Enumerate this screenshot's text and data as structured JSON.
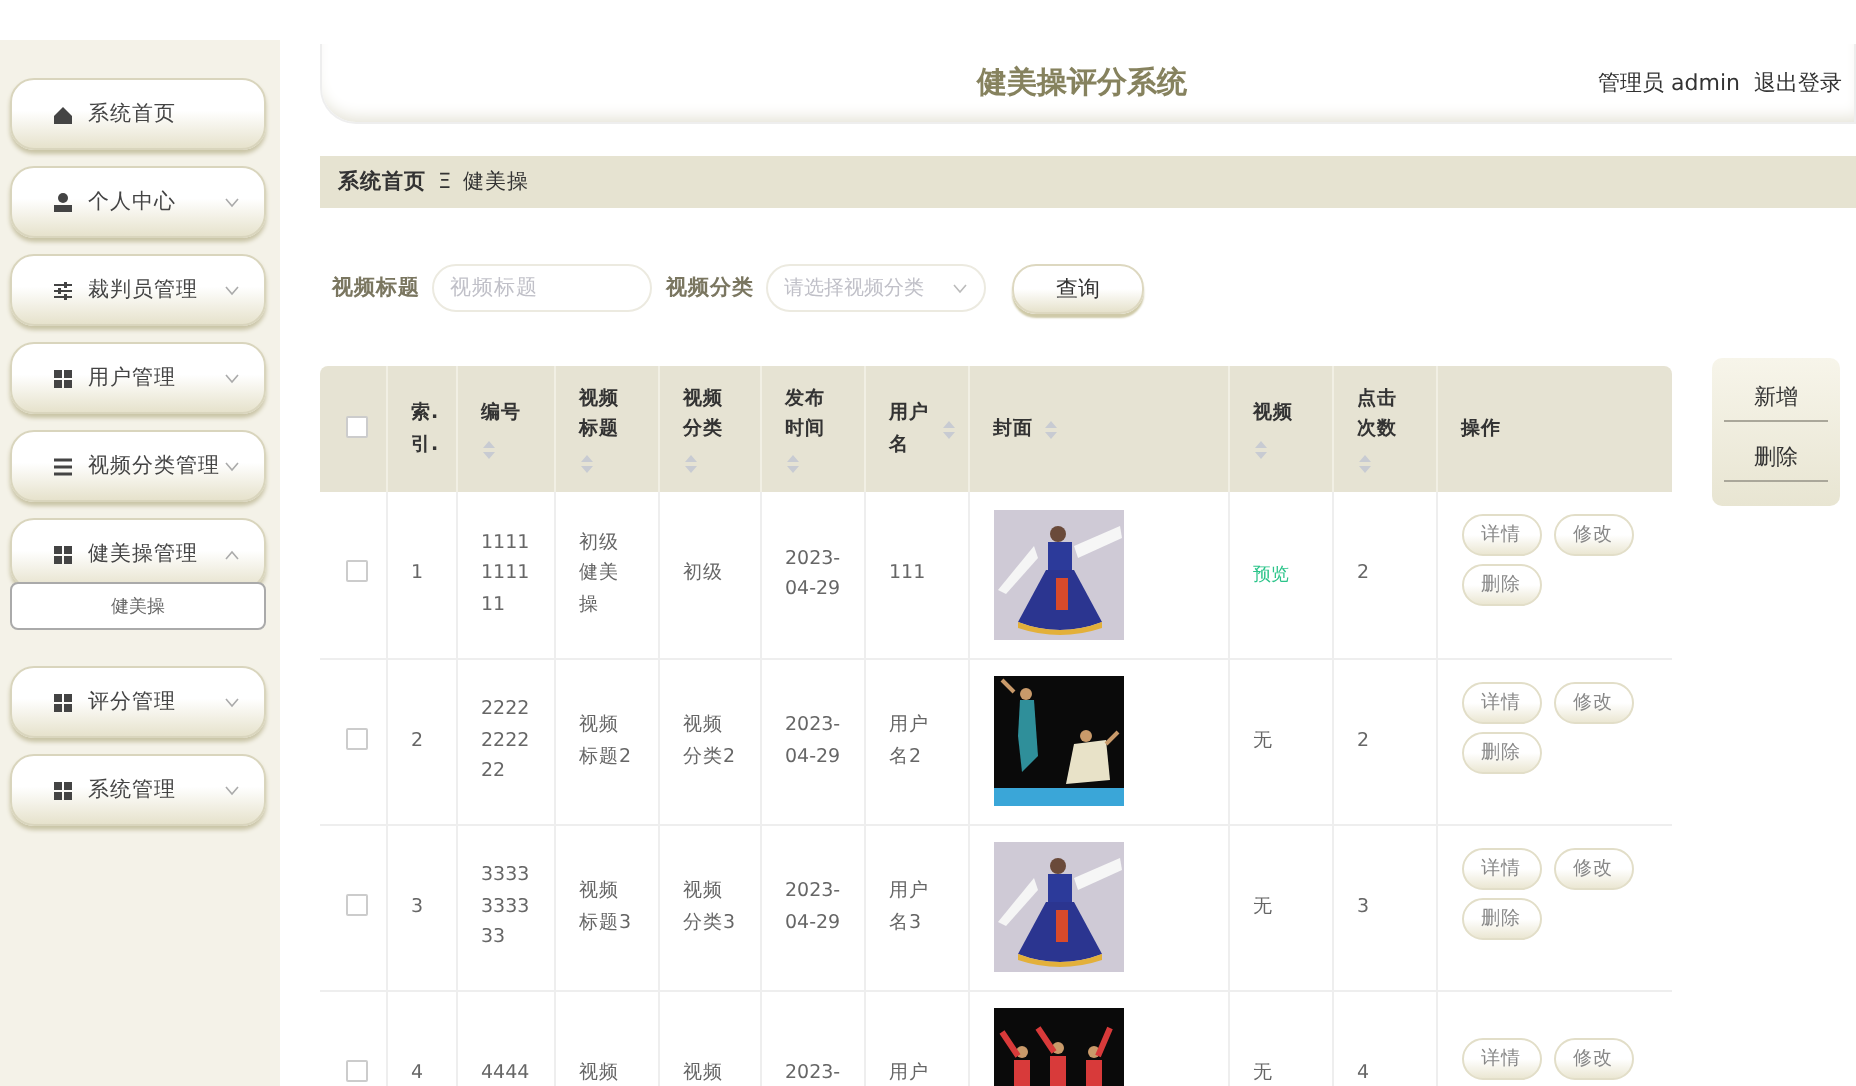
{
  "sidebar": {
    "items": [
      {
        "label": "系统首页",
        "kind": "link"
      },
      {
        "label": "个人中心",
        "kind": "menu",
        "expanded": false
      },
      {
        "label": "裁判员管理",
        "kind": "menu",
        "expanded": false
      },
      {
        "label": "用户管理",
        "kind": "menu",
        "expanded": false
      },
      {
        "label": "视频分类管理",
        "kind": "menu",
        "expanded": false
      },
      {
        "label": "健美操管理",
        "kind": "menu",
        "expanded": true,
        "children": [
          {
            "label": "健美操",
            "selected": true
          }
        ]
      },
      {
        "label": "评分管理",
        "kind": "menu",
        "expanded": false
      },
      {
        "label": "系统管理",
        "kind": "menu",
        "expanded": false
      }
    ]
  },
  "header": {
    "title": "健美操评分系统",
    "user": "管理员 admin",
    "logout": "退出登录"
  },
  "breadcrumb": {
    "home": "系统首页",
    "separator": "Ξ",
    "current": "健美操"
  },
  "search": {
    "fields": [
      {
        "label": "视频标题",
        "kind": "input",
        "placeholder": "视频标题"
      },
      {
        "label": "视频分类",
        "kind": "select",
        "placeholder": "请选择视频分类"
      }
    ],
    "button": "查询"
  },
  "side_actions": [
    "新增",
    "删除"
  ],
  "table": {
    "select_all": {
      "checked": false
    },
    "columns": [
      {
        "label": "索.引.",
        "sortable": false
      },
      {
        "label": "编号",
        "sortable": true
      },
      {
        "label": "视频标题",
        "sortable": true
      },
      {
        "label": "视频分类",
        "sortable": true
      },
      {
        "label": "发布时间",
        "sortable": true
      },
      {
        "label": "用户名",
        "sortable": true
      },
      {
        "label": "封面",
        "sortable": true
      },
      {
        "label": "视频",
        "sortable": true
      },
      {
        "label": "点击次数",
        "sortable": true
      },
      {
        "label": "操作",
        "sortable": false
      }
    ],
    "rows": [
      {
        "checked": false,
        "index": "1",
        "number": "1111111111",
        "title": "初级健美操",
        "category": "初级",
        "date": "2023-04-29",
        "user": "111",
        "cover": {
          "kind": "picture"
        },
        "video": {
          "text": "预览",
          "kind": "link"
        },
        "clicks": "2",
        "actions": [
          "详情",
          "修改",
          "删除"
        ]
      },
      {
        "checked": false,
        "index": "2",
        "number": "2222222222",
        "title": "视频标题2",
        "category": "视频分类2",
        "date": "2023-04-29",
        "user": "用户名2",
        "cover": {
          "kind": "picture"
        },
        "video": {
          "text": "无",
          "kind": "text"
        },
        "clicks": "2",
        "actions": [
          "详情",
          "修改",
          "删除"
        ]
      },
      {
        "checked": false,
        "index": "3",
        "number": "3333333333",
        "title": "视频标题3",
        "category": "视频分类3",
        "date": "2023-04-29",
        "user": "用户名3",
        "cover": {
          "kind": "picture"
        },
        "video": {
          "text": "无",
          "kind": "text"
        },
        "clicks": "3",
        "actions": [
          "详情",
          "修改",
          "删除"
        ]
      },
      {
        "checked": false,
        "index": "4",
        "number": "4444",
        "title": "视频",
        "category": "视频",
        "date": "2023-",
        "user": "用户",
        "cover": {
          "kind": "picture"
        },
        "video": {
          "text": "无",
          "kind": "text"
        },
        "clicks": "4",
        "actions": [
          "详情",
          "修改"
        ]
      }
    ]
  }
}
